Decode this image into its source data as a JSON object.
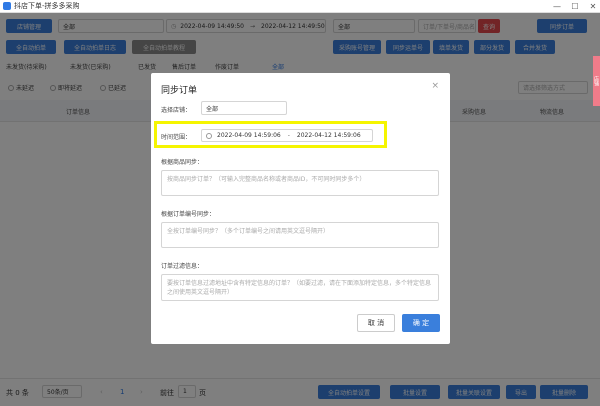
{
  "window": {
    "title": "抖店下单-拼多多采购",
    "controls": [
      "—",
      "☐",
      "✕"
    ]
  },
  "toolbar": {
    "store_button": "店铺管理",
    "store_select": "全部",
    "date_start": "2022-04-09 14:49:50",
    "date_sep": "→",
    "date_end": "2022-04-12 14:49:50",
    "all_select": "全部",
    "search_placeholder": "订单/下单号/商品名/收件人/",
    "query_button": "查询",
    "sync_button": "同步订单",
    "auto_order_button": "全自动拍单",
    "auto_log_button": "全自动拍单日志",
    "auto_tutorial_button": "全自动拍单教程",
    "purchase_account_button": "采购账号管理",
    "sync_purchase_button": "同步运单号",
    "ship_button": "填单发货",
    "partial_ship_button": "部分发货",
    "merge_ship_button": "合并发货"
  },
  "tabs": [
    "未发货(待采购)",
    "未发货(已采购)",
    "已发货",
    "售后订单",
    "作废订单",
    "全部"
  ],
  "radios": [
    "未延迟",
    "即将延迟",
    "已延迟"
  ],
  "filter_placeholder": "请选择筛选方式",
  "table": {
    "headers": [
      "订单信息",
      "采购信息",
      "物流信息"
    ]
  },
  "footer": {
    "total": "共 0 条",
    "page_size": "50条/页",
    "page": "1",
    "goto_label": "前往",
    "goto_value": "1",
    "page_unit": "页",
    "auto_settings": "全自动拍单设置",
    "batch_settings": "批量设置",
    "batch_associate": "批量关联设置",
    "export": "导出",
    "batch_delete": "批量删除"
  },
  "side_badge": "店铺",
  "dialog": {
    "title": "同步订单",
    "close": "×",
    "store_label": "选择店铺：",
    "store_value": "全部",
    "time_label": "时间范围：",
    "time_start": "2022-04-09 14:59:06",
    "time_sep": "-",
    "time_end": "2022-04-12 14:59:06",
    "product_label": "根据商品同步：",
    "product_placeholder": "按商品同步订单？（可输入完整商品名称或者商品ID，不可同时同步多个）",
    "order_label": "根据订单编号同步：",
    "order_placeholder": "全按订单编号同步？（多个订单编号之间请用英文逗号隔开）",
    "filter_label": "订单过滤信息：",
    "filter_placeholder_1": "要按订单信息过滤地址中含有特定信息的订单？（如要过滤，请在下面添加特定信息，多个特定信息之间使用英文逗号隔开）",
    "cancel": "取 消",
    "confirm": "确 定"
  },
  "colors": {
    "primary": "#3a7fdc",
    "danger": "#e5484d",
    "highlight": "#f5f500"
  }
}
